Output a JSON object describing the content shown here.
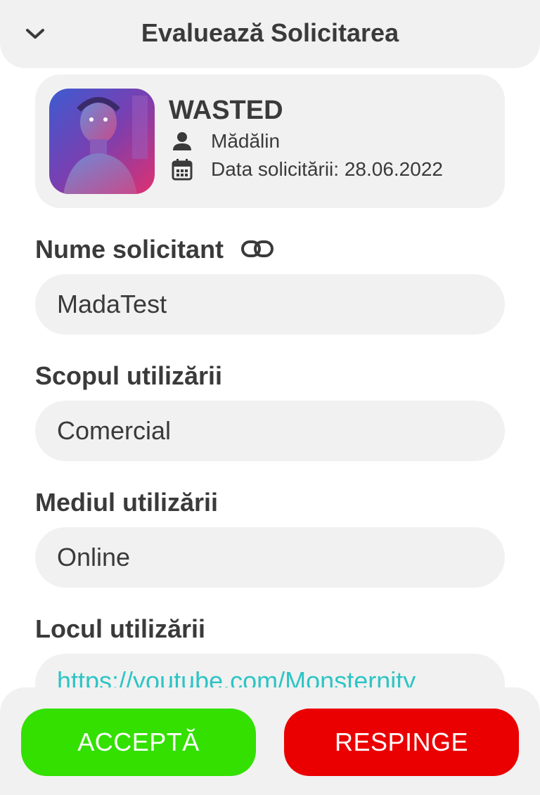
{
  "header": {
    "title": "Evaluează Solicitarea",
    "collapse_icon": "chevron-down-icon"
  },
  "request_card": {
    "work_title": "WASTED",
    "author": "Mădălin",
    "date_text": "Data solicitării: 28.06.2022",
    "icons": [
      "person-icon",
      "calendar-icon"
    ]
  },
  "fields": {
    "applicant_name": {
      "label": "Nume solicitant",
      "value": "MadaTest",
      "icon": "link-icon"
    },
    "usage_purpose": {
      "label": "Scopul utilizării",
      "value": "Comercial"
    },
    "usage_medium": {
      "label": "Mediul utilizării",
      "value": "Online"
    },
    "usage_place": {
      "label": "Locul utilizării",
      "value": "https://youtube.com/Monsternity"
    }
  },
  "actions": {
    "accept_label": "ACCEPTĂ",
    "reject_label": "RESPINGE"
  },
  "colors": {
    "accept": "#33e000",
    "reject": "#ea0000",
    "link": "#2ec4c4",
    "surface": "#f1f1f1",
    "text": "#3a3a3a"
  }
}
